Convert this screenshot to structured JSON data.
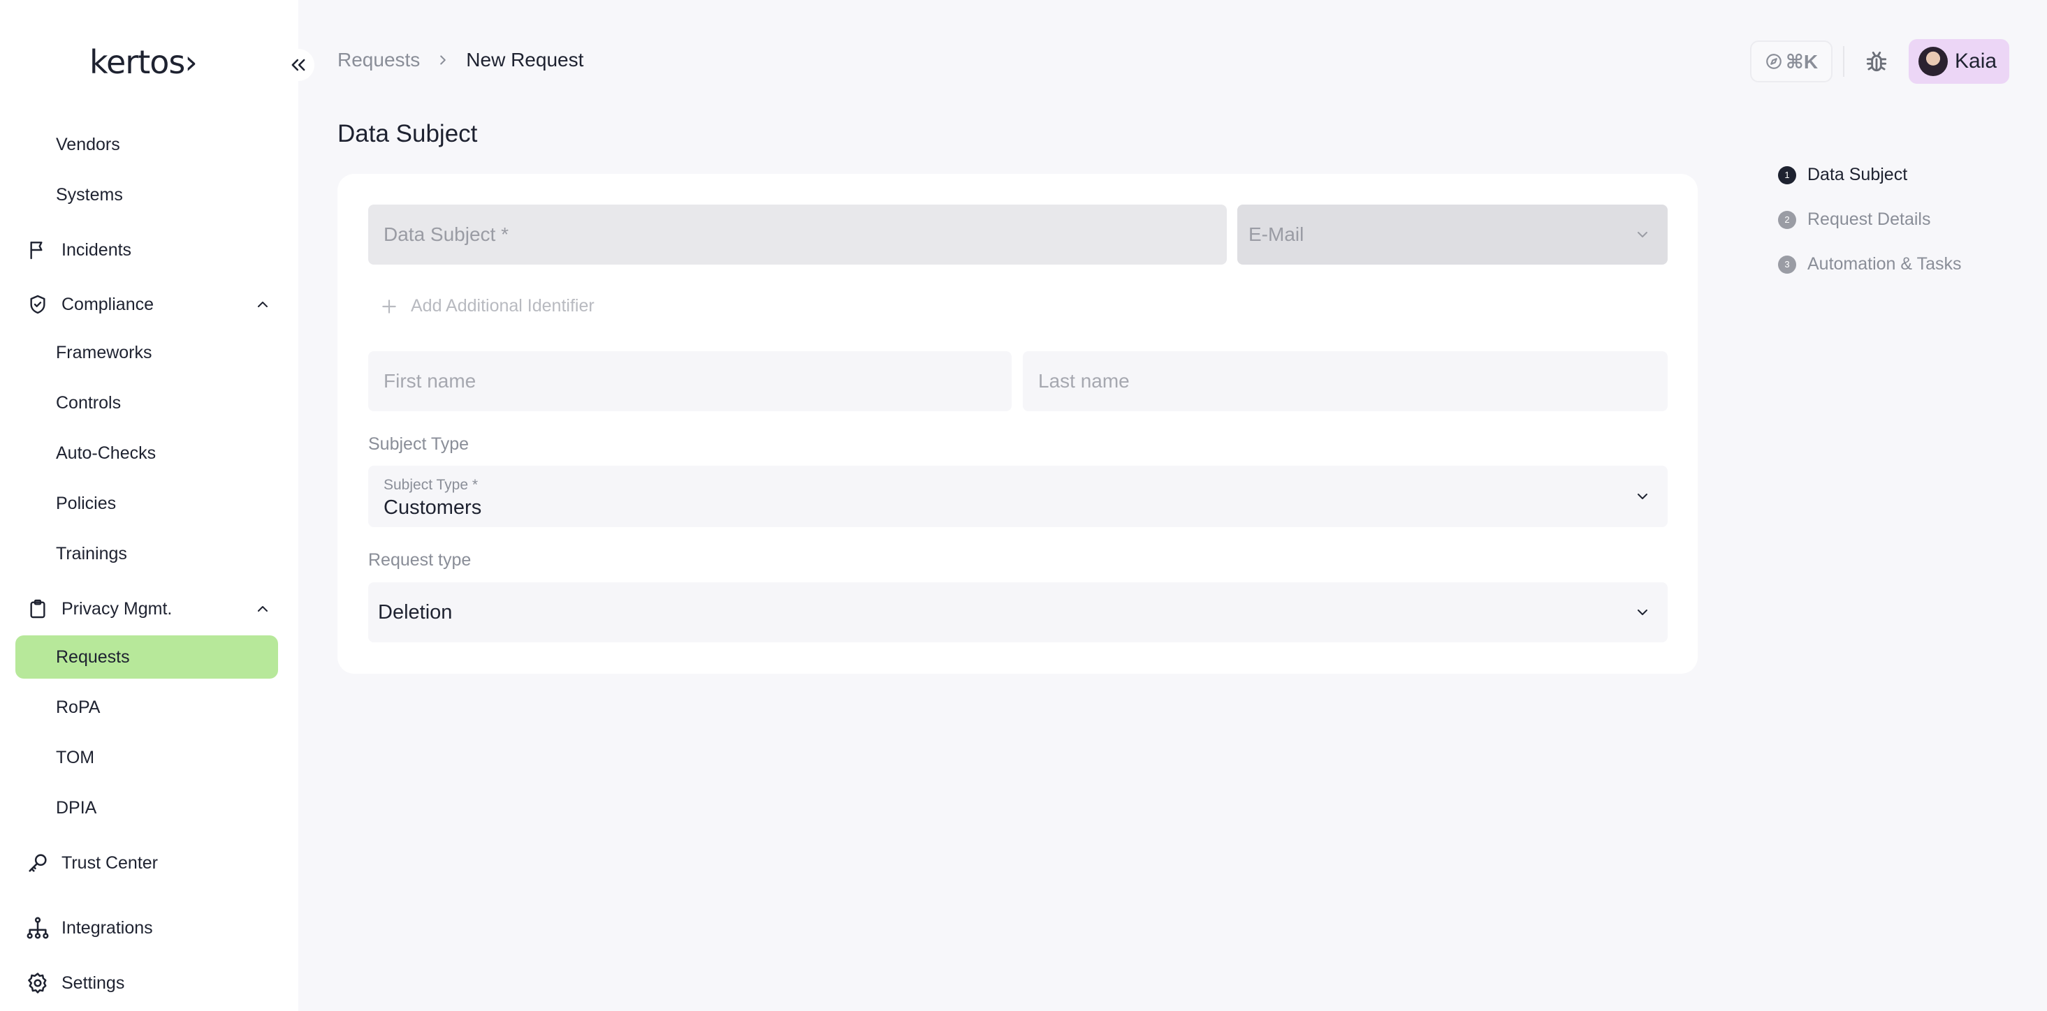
{
  "app": {
    "logo_text": "kertos›"
  },
  "sidebar": {
    "items": [
      {
        "label": "Vendors",
        "type": "sub"
      },
      {
        "label": "Systems",
        "type": "sub"
      },
      {
        "label": "Incidents",
        "type": "main",
        "icon": "flag-icon"
      },
      {
        "label": "Compliance",
        "type": "main",
        "icon": "shield-check-icon",
        "expanded": true
      },
      {
        "label": "Frameworks",
        "type": "sub"
      },
      {
        "label": "Controls",
        "type": "sub"
      },
      {
        "label": "Auto-Checks",
        "type": "sub"
      },
      {
        "label": "Policies",
        "type": "sub"
      },
      {
        "label": "Trainings",
        "type": "sub"
      },
      {
        "label": "Privacy Mgmt.",
        "type": "main",
        "icon": "clipboard-icon",
        "expanded": true
      },
      {
        "label": "Requests",
        "type": "sub",
        "active": true
      },
      {
        "label": "RoPA",
        "type": "sub"
      },
      {
        "label": "TOM",
        "type": "sub"
      },
      {
        "label": "DPIA",
        "type": "sub"
      },
      {
        "label": "Trust Center",
        "type": "main",
        "icon": "key-icon"
      },
      {
        "label": "Integrations",
        "type": "main",
        "icon": "network-icon"
      },
      {
        "label": "Settings",
        "type": "main",
        "icon": "gear-icon"
      }
    ],
    "active_color": "#b7e89a"
  },
  "header": {
    "breadcrumb": {
      "parent": "Requests",
      "current": "New Request"
    },
    "command_shortcut": "⌘K",
    "user": {
      "name": "Kaia",
      "chip_color": "#ecd6f6"
    }
  },
  "form": {
    "title": "Data Subject",
    "data_subject_placeholder": "Data Subject *",
    "identifier_type_placeholder": "E-Mail",
    "add_identifier_label": "Add Additional Identifier",
    "first_name_placeholder": "First name",
    "last_name_placeholder": "Last name",
    "subject_type": {
      "section_label": "Subject Type",
      "floating_label": "Subject Type *",
      "value": "Customers"
    },
    "request_type": {
      "section_label": "Request type",
      "value": "Deletion"
    }
  },
  "stepper": {
    "steps": [
      {
        "number": "1",
        "label": "Data Subject",
        "active": true
      },
      {
        "number": "2",
        "label": "Request Details",
        "active": false
      },
      {
        "number": "3",
        "label": "Automation & Tasks",
        "active": false
      }
    ]
  }
}
